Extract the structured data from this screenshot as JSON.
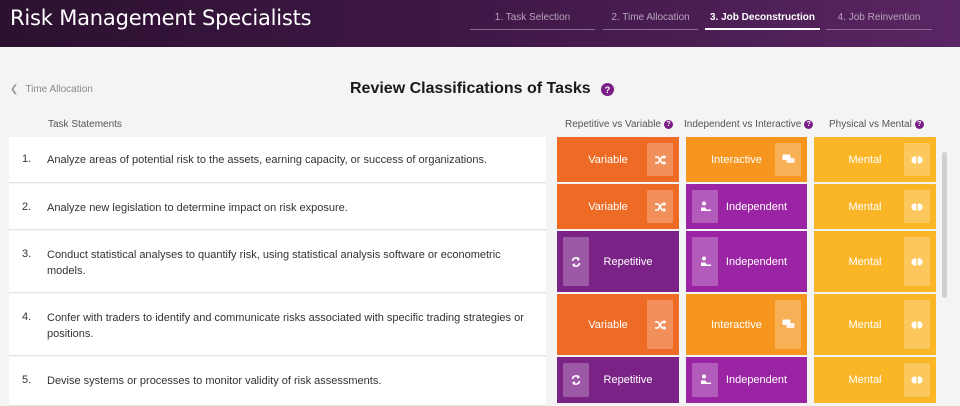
{
  "app": {
    "title": "Risk Management Specialists"
  },
  "steps": [
    {
      "label": "1.  Task Selection",
      "active": false
    },
    {
      "label": "2.  Time Allocation",
      "active": false
    },
    {
      "label": "3.  Job Deconstruction",
      "active": true
    },
    {
      "label": "4.  Job Reinvention",
      "active": false
    }
  ],
  "back": {
    "label": "Time Allocation"
  },
  "page": {
    "title": "Review Classifications of Tasks",
    "help": "?"
  },
  "columns": {
    "task": "Task Statements",
    "rep_var": "Repetitive vs Variable",
    "ind_int": "Independent vs Interactive",
    "phys_ment": "Physical vs Mental"
  },
  "tasks": [
    {
      "num": "1.",
      "text": "Analyze areas of potential risk to the assets, earning capacity, or success of organizations.",
      "rep_var": "Variable",
      "ind_int": "Interactive",
      "phys_ment": "Mental"
    },
    {
      "num": "2.",
      "text": "Analyze new legislation to determine impact on risk exposure.",
      "rep_var": "Variable",
      "ind_int": "Independent",
      "phys_ment": "Mental"
    },
    {
      "num": "3.",
      "text": "Conduct statistical analyses to quantify risk, using statistical analysis software or econometric models.",
      "rep_var": "Repetitive",
      "ind_int": "Independent",
      "phys_ment": "Mental"
    },
    {
      "num": "4.",
      "text": "Confer with traders to identify and communicate risks associated with specific trading strategies or positions.",
      "rep_var": "Variable",
      "ind_int": "Interactive",
      "phys_ment": "Mental"
    },
    {
      "num": "5.",
      "text": "Devise systems or processes to monitor validity of risk assessments.",
      "rep_var": "Repetitive",
      "ind_int": "Independent",
      "phys_ment": "Mental"
    }
  ],
  "icons": {
    "variable": "shuffle-icon",
    "repetitive": "repeat-icon",
    "interactive": "chat-icon",
    "independent": "person-desk-icon",
    "mental": "brain-icon"
  },
  "colors": {
    "variable": "#ee6b25",
    "interactive": "#f6961e",
    "mental": "#fbb628",
    "repetitive": "#7b2287",
    "independent": "#9a24a3",
    "help": "#7a1d86"
  }
}
